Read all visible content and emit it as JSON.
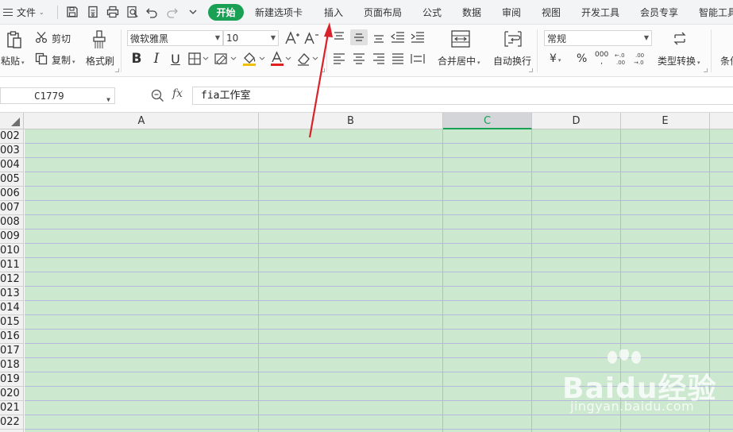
{
  "menubar": {
    "file_label": "文件",
    "tabs": {
      "start": "开始",
      "new_tab": "新建选项卡",
      "insert": "插入",
      "page_layout": "页面布局",
      "formulas": "公式",
      "data": "数据",
      "review": "审阅",
      "view": "视图",
      "developer": "开发工具",
      "member": "会员专享",
      "smart_tools": "智能工具"
    },
    "active_tab_color": "#1aa054"
  },
  "ribbon": {
    "paste_label": "粘贴",
    "cut_label": "剪切",
    "copy_label": "复制",
    "format_painter_label": "格式刷",
    "font_name": "微软雅黑",
    "font_size": "10",
    "merge_center_label": "合并居中",
    "wrap_text_label": "自动换行",
    "number_format": "常规",
    "convert_type_label": "类型转换",
    "conditional_label": "条件",
    "currency_symbol": "¥",
    "percent_symbol": "%",
    "thousands_symbol": "000",
    "font_color": "#e02020"
  },
  "formula_bar": {
    "cell_reference": "C1779",
    "fx_label": "fx",
    "content": "fia工作室"
  },
  "grid": {
    "columns": [
      "A",
      "B",
      "C",
      "D",
      "E"
    ],
    "active_column": "C",
    "rows": [
      "002",
      "003",
      "004",
      "005",
      "006",
      "007",
      "008",
      "009",
      "010",
      "011",
      "012",
      "013",
      "014",
      "015",
      "016",
      "017",
      "018",
      "019",
      "020",
      "021",
      "022"
    ],
    "cell_fill_color": "#cce8cf",
    "gridline_color": "#b6b8dc"
  },
  "watermark": {
    "brand": "Baidu经验",
    "url": "jingyan.baidu.com"
  },
  "annotation": {
    "arrow_color": "#d9232a"
  }
}
